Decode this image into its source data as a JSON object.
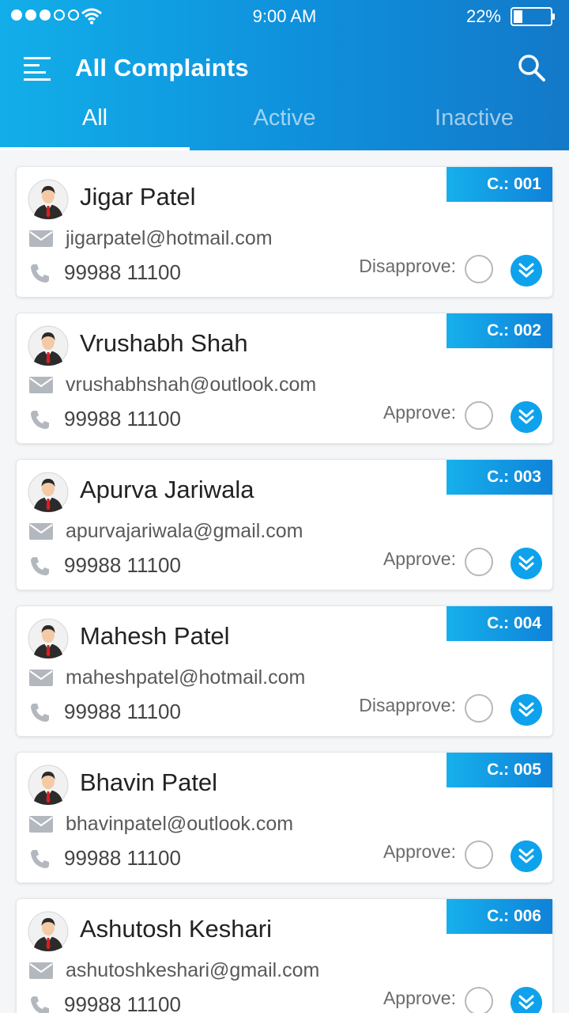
{
  "status_bar": {
    "time": "9:00 AM",
    "battery": "22%"
  },
  "header": {
    "title": "All Complaints"
  },
  "tabs": [
    {
      "label": "All"
    },
    {
      "label": "Active"
    },
    {
      "label": "Inactive"
    }
  ],
  "complaints": [
    {
      "code": "C.: 001",
      "name": "Jigar Patel",
      "email": "jigarpatel@hotmail.com",
      "phone": "99988 11100",
      "status_label": "Disapprove:"
    },
    {
      "code": "C.: 002",
      "name": "Vrushabh Shah",
      "email": "vrushabhshah@outlook.com",
      "phone": "99988 11100",
      "status_label": "Approve:"
    },
    {
      "code": "C.: 003",
      "name": "Apurva Jariwala",
      "email": "apurvajariwala@gmail.com",
      "phone": "99988 11100",
      "status_label": "Approve:"
    },
    {
      "code": "C.: 004",
      "name": "Mahesh Patel",
      "email": "maheshpatel@hotmail.com",
      "phone": "99988 11100",
      "status_label": "Disapprove:"
    },
    {
      "code": "C.: 005",
      "name": "Bhavin Patel",
      "email": "bhavinpatel@outlook.com",
      "phone": "99988 11100",
      "status_label": "Approve:"
    },
    {
      "code": "C.: 006",
      "name": "Ashutosh Keshari",
      "email": "ashutoshkeshari@gmail.com",
      "phone": "99988 11100",
      "status_label": "Approve:"
    }
  ],
  "colors": {
    "header_start": "#12aee9",
    "header_end": "#1379c9",
    "accent": "#0ea2ec"
  }
}
